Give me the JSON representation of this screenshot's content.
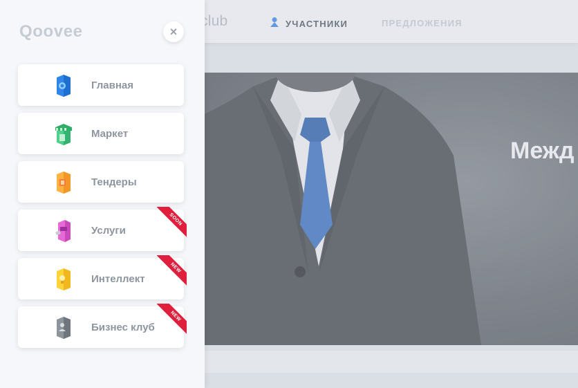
{
  "background": {
    "brand_partial": "club",
    "nav": [
      {
        "label": "УЧАСТНИКИ",
        "active": true
      },
      {
        "label": "ПРЕДЛОЖЕНИЯ",
        "active": false
      }
    ],
    "hero_title": "Межд"
  },
  "drawer": {
    "logo": "Qoovee",
    "close_label": "×",
    "items": [
      {
        "label": "Главная",
        "icon": "home-icon",
        "badge": ""
      },
      {
        "label": "Маркет",
        "icon": "market-icon",
        "badge": ""
      },
      {
        "label": "Тендеры",
        "icon": "tenders-icon",
        "badge": ""
      },
      {
        "label": "Услуги",
        "icon": "services-icon",
        "badge": "SOON"
      },
      {
        "label": "Интеллект",
        "icon": "intellect-icon",
        "badge": "NEW"
      },
      {
        "label": "Бизнес клуб",
        "icon": "business-club-icon",
        "badge": "NEW"
      }
    ]
  },
  "colors": {
    "accent_blue": "#4a90e2",
    "badge_red": "#e01f3d"
  }
}
